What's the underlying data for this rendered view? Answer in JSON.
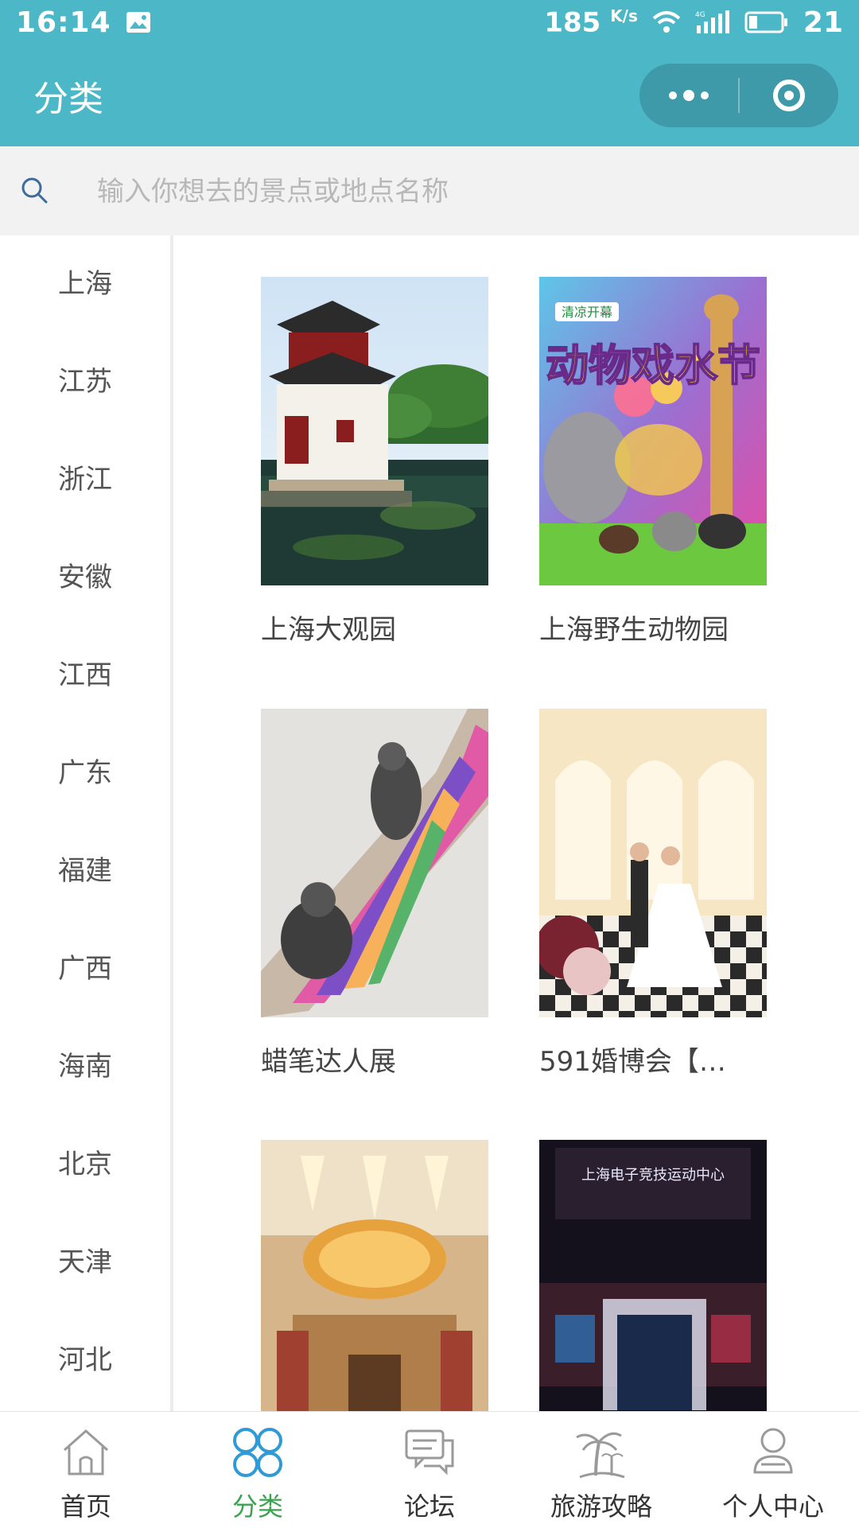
{
  "status_bar": {
    "time": "16:14",
    "speed": "185",
    "speed_unit": "K/s",
    "network": "4G",
    "battery": "21"
  },
  "nav": {
    "title": "分类"
  },
  "search": {
    "placeholder": "输入你想去的景点或地点名称",
    "value": ""
  },
  "sidebar": {
    "items": [
      {
        "label": "上海"
      },
      {
        "label": "江苏"
      },
      {
        "label": "浙江"
      },
      {
        "label": "安徽"
      },
      {
        "label": "江西"
      },
      {
        "label": "广东"
      },
      {
        "label": "福建"
      },
      {
        "label": "广西"
      },
      {
        "label": "海南"
      },
      {
        "label": "北京"
      },
      {
        "label": "天津"
      },
      {
        "label": "河北"
      }
    ]
  },
  "spots": [
    {
      "name": "上海大观园"
    },
    {
      "name": "上海野生动物园"
    },
    {
      "name": "蜡笔达人展"
    },
    {
      "name": "591婚博会【…"
    },
    {
      "name": ""
    },
    {
      "name": ""
    }
  ],
  "spot_image_text": {
    "zoo_banner": "动物戏水节",
    "zoo_tag": "清凉开幕",
    "esports_sign": "上海电子竞技运动中心"
  },
  "tabbar": {
    "items": [
      {
        "label": "首页",
        "icon": "home-icon"
      },
      {
        "label": "分类",
        "icon": "category-icon"
      },
      {
        "label": "论坛",
        "icon": "forum-icon"
      },
      {
        "label": "旅游攻略",
        "icon": "palm-tree-icon"
      },
      {
        "label": "个人中心",
        "icon": "user-icon"
      }
    ],
    "active_index": 1
  },
  "colors": {
    "primary": "#4cb7c6",
    "active_tab": "#3ba34f",
    "search_bg": "#f2f2f2"
  }
}
